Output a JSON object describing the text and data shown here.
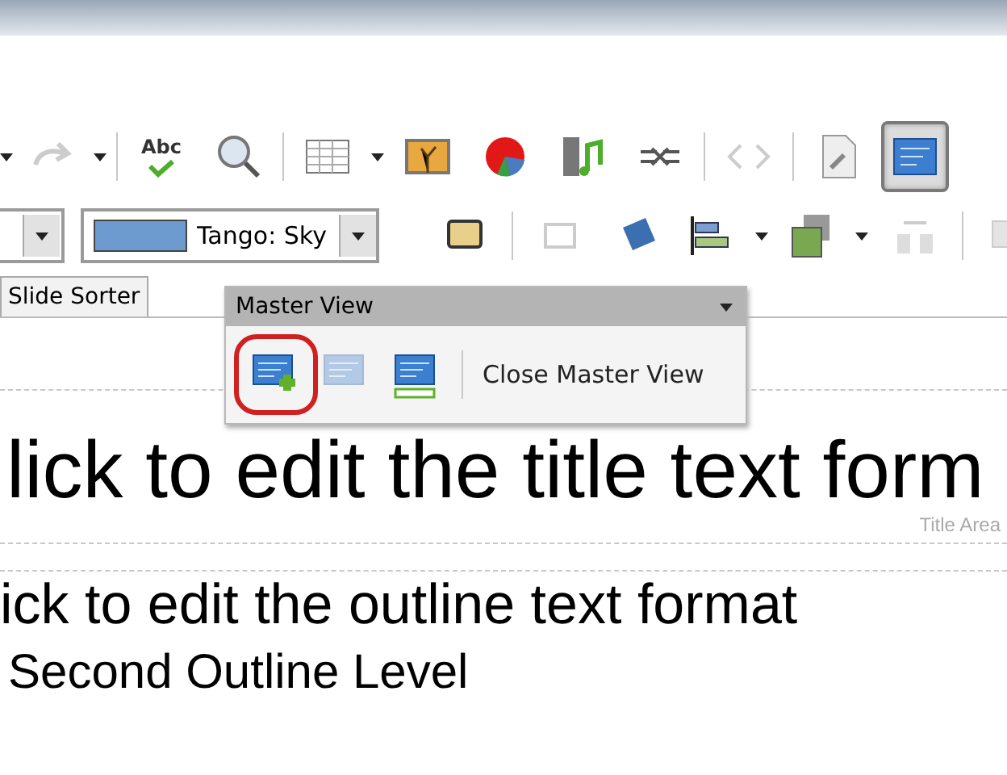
{
  "standard_toolbar": {
    "spellcheck_label": "Abc",
    "view_button": {
      "selected": true
    }
  },
  "line_toolbar": {
    "fill_color": {
      "value": "Tango: Sky",
      "color": "#6d9bd0"
    }
  },
  "view_tabs": [
    {
      "label": "Slide Sorter",
      "selected": false
    }
  ],
  "master_view_toolbar": {
    "title": "Master View",
    "buttons": [
      {
        "kind": "new",
        "disabled": false,
        "highlighted": true
      },
      {
        "kind": "delete",
        "disabled": true,
        "highlighted": false
      },
      {
        "kind": "rename",
        "disabled": false,
        "highlighted": false
      }
    ],
    "close_label": "Close Master View"
  },
  "slide": {
    "title": "lick to edit the title text form",
    "title_area_label": "Title Area",
    "outline": "ick to edit the outline text format",
    "second_level": "Second Outline Level"
  }
}
